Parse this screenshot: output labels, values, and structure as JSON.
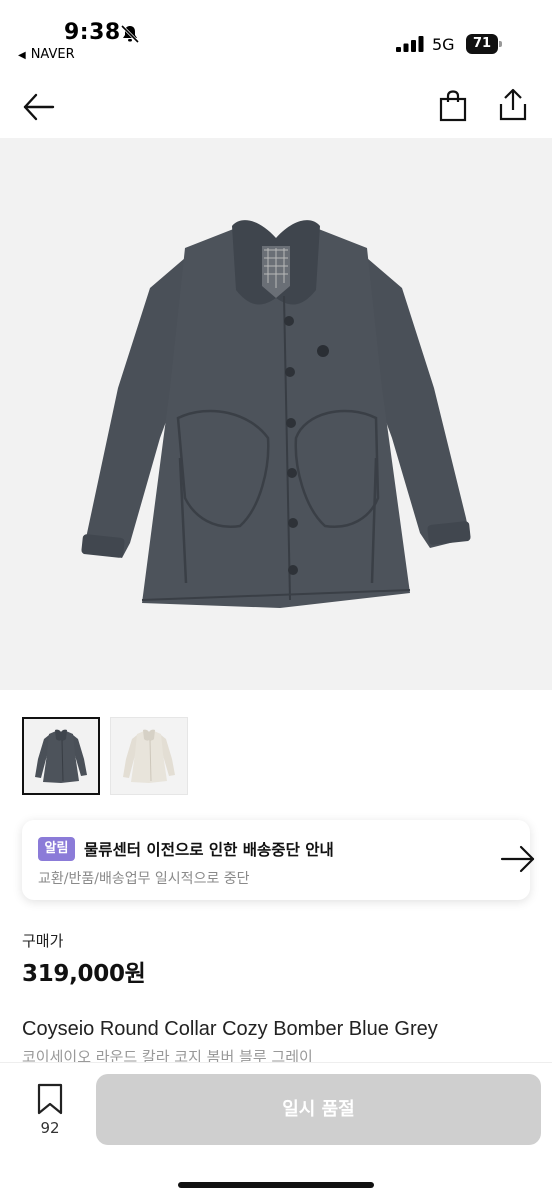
{
  "status_bar": {
    "time": "9:38",
    "back_app": "NAVER",
    "network": "5G",
    "battery": "71"
  },
  "nav": {
    "icons": [
      "back-arrow-icon",
      "shopping-bag-icon",
      "share-icon"
    ]
  },
  "notice": {
    "badge": "알림",
    "title": "물류센터 이전으로 인한 배송중단 안내",
    "subtitle": "교환/반품/배송업무 일시적으로 중단"
  },
  "price": {
    "label": "구매가",
    "value": "319,000원"
  },
  "product": {
    "name_en": "Coyseio Round Collar Cozy Bomber Blue Grey",
    "name_ko": "코이세이오 라운드 칼라 코지 봄버 블루 그레이"
  },
  "bottom_bar": {
    "wish_count": "92",
    "soldout_label": "일시 품절"
  },
  "colors": {
    "accent_badge": "#8b7bd8",
    "disabled_button": "#cfcfcf",
    "jacket_grey": "#4a5058",
    "jacket_cream": "#e3ded4"
  }
}
